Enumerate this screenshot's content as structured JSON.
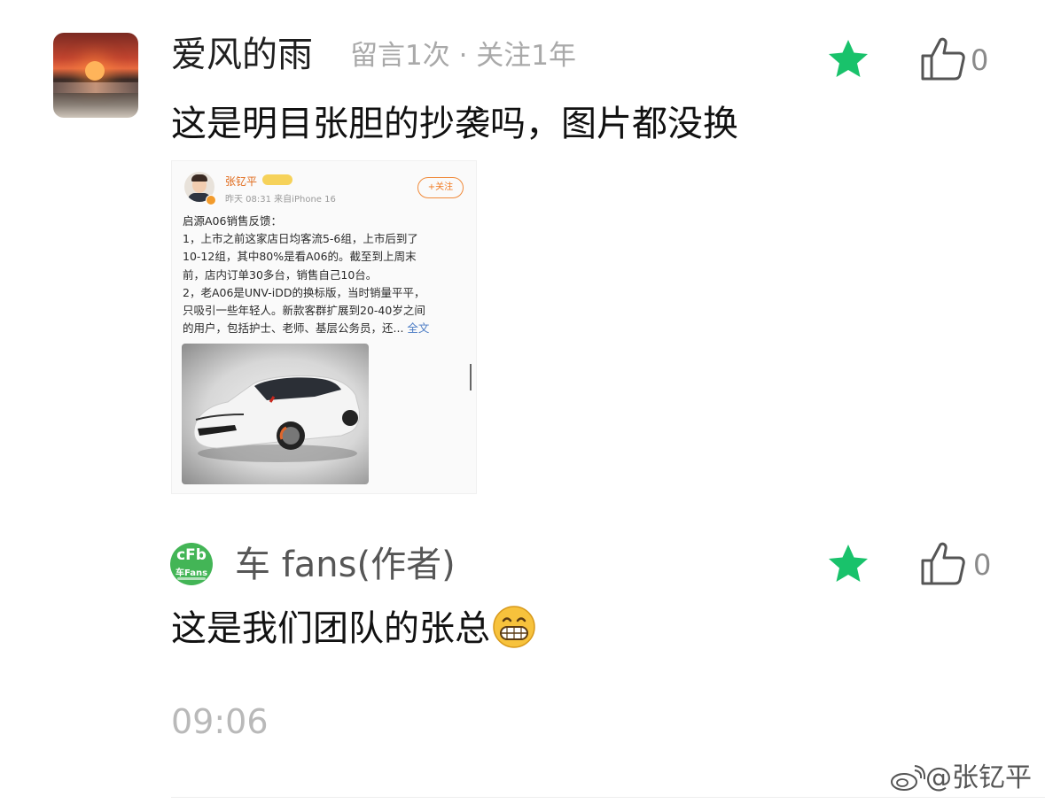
{
  "comments": [
    {
      "user_name": "爱风的雨",
      "meta": "留言1次 · 关注1年",
      "text": "这是明目张胆的抄袭吗，图片都没换",
      "like_count": "0",
      "starred": true,
      "star_color": "#19c26b"
    },
    {
      "user_name": "车 fans(作者)",
      "text": "这是我们团队的张总",
      "like_count": "0",
      "starred": true,
      "star_color": "#19c26b",
      "avatar_logo": "cFb",
      "avatar_logo_sub": "车Fans"
    }
  ],
  "attached_screenshot": {
    "user_name": "张钇平",
    "user_info": "昨天 08:31  来自iPhone 16",
    "follow_label": "+关注",
    "lines": [
      "启源A06销售反馈：",
      "1，上市之前这家店日均客流5-6组，上市后到了",
      "10-12组，其中80%是看A06的。截至到上周末",
      "前，店内订单30多台，销售自己10台。",
      "2，老A06是UNV-iDD的换标版，当时销量平平，",
      "只吸引一些年轻人。新款客群扩展到20-40岁之间",
      "的用户，包括护士、老师、基层公务员，还..."
    ],
    "more_label": "全文"
  },
  "timestamp": "09:06",
  "watermark": "@张钇平"
}
